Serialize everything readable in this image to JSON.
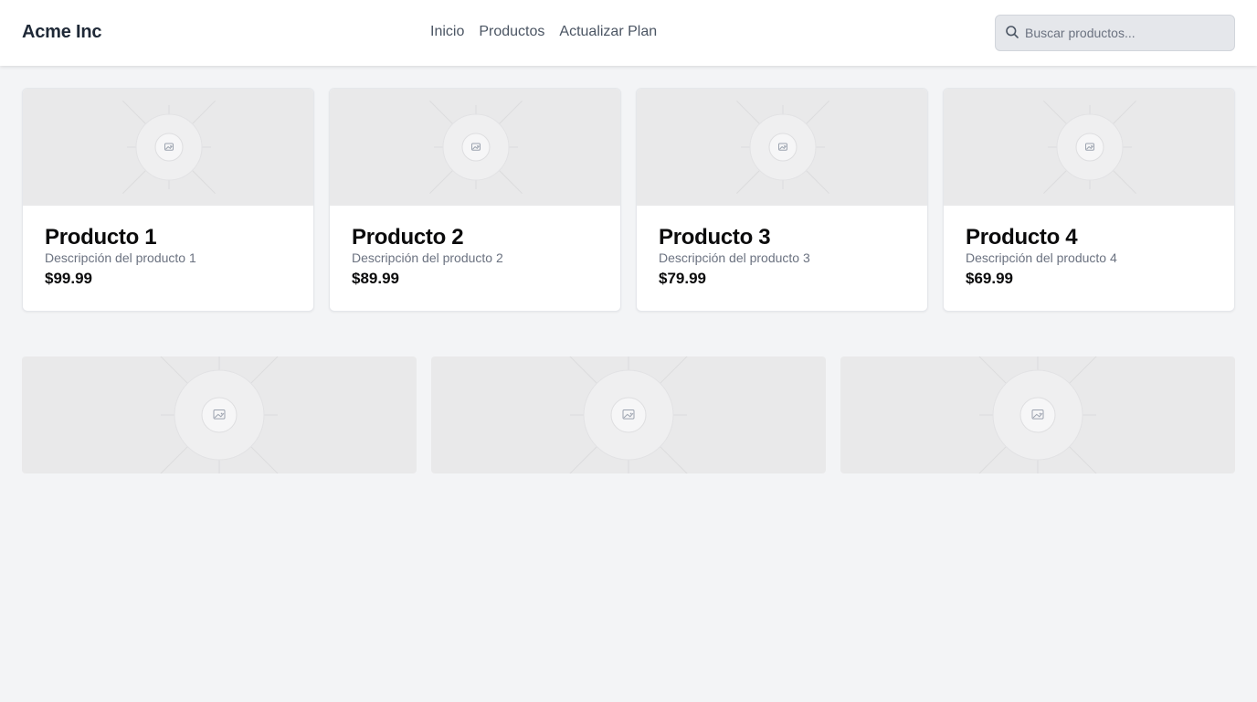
{
  "header": {
    "brand": "Acme Inc",
    "nav": [
      {
        "label": "Inicio"
      },
      {
        "label": "Productos"
      },
      {
        "label": "Actualizar Plan"
      }
    ],
    "search": {
      "placeholder": "Buscar productos...",
      "value": "",
      "icon": "search-icon"
    }
  },
  "products": [
    {
      "title": "Producto 1",
      "description": "Descripción del producto 1",
      "price": "$99.99",
      "image_icon": "image-placeholder-icon"
    },
    {
      "title": "Producto 2",
      "description": "Descripción del producto 2",
      "price": "$89.99",
      "image_icon": "image-placeholder-icon"
    },
    {
      "title": "Producto 3",
      "description": "Descripción del producto 3",
      "price": "$79.99",
      "image_icon": "image-placeholder-icon"
    },
    {
      "title": "Producto 4",
      "description": "Descripción del producto 4",
      "price": "$69.99",
      "image_icon": "image-placeholder-icon"
    }
  ],
  "tiles": [
    {
      "image_icon": "image-placeholder-icon"
    },
    {
      "image_icon": "image-placeholder-icon"
    },
    {
      "image_icon": "image-placeholder-icon"
    }
  ],
  "colors": {
    "background": "#f3f4f6",
    "header_bg": "#ffffff",
    "placeholder_bg": "#e9e9ea",
    "text_primary": "#0b0b0c",
    "text_muted": "#6b7280"
  }
}
